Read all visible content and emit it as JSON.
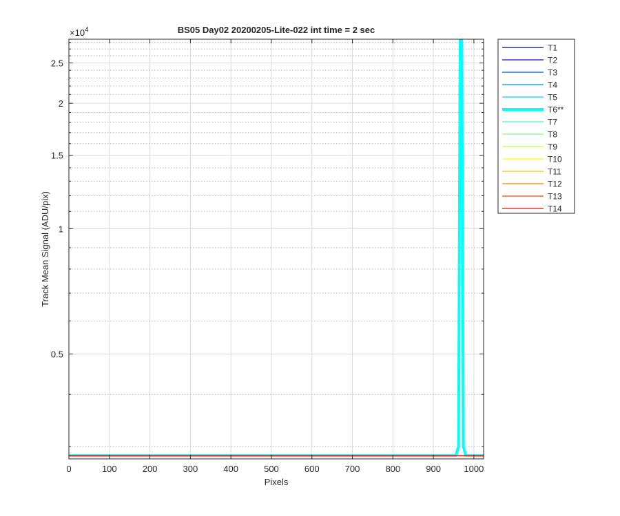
{
  "chart_data": {
    "type": "line",
    "title": "BS05 Day02 20200205-Lite-022 int time = 2 sec",
    "xlabel": "Pixels",
    "ylabel": "Track Mean Signal (ADU/pix)",
    "y_exponent_label": "×10",
    "y_exponent_power": "4",
    "y_scale": "log",
    "xlim": [
      0,
      1024
    ],
    "ylim": [
      2800,
      28500
    ],
    "grid": true,
    "legend_position": "outside-right",
    "x_ticks": [
      0,
      100,
      200,
      300,
      400,
      500,
      600,
      700,
      800,
      900,
      1000
    ],
    "x_tick_labels": [
      "0",
      "100",
      "200",
      "300",
      "400",
      "500",
      "600",
      "700",
      "800",
      "900",
      "1000"
    ],
    "y_ticks_major": [
      5000,
      10000,
      15000,
      20000,
      25000
    ],
    "y_tick_labels": [
      "0.5",
      "1",
      "1.5",
      "2",
      "2.5"
    ],
    "y_ticks_minor": [
      3000,
      4000,
      6000,
      7000,
      8000,
      9000,
      11000,
      12000,
      13000,
      14000,
      16000,
      17000,
      18000,
      19000,
      21000,
      22000,
      23000,
      24000,
      26000,
      27000,
      28000
    ],
    "baseline_value": 2850,
    "series": [
      {
        "name": "T1",
        "color": "#00008f",
        "width": 1.3,
        "values": []
      },
      {
        "name": "T2",
        "color": "#0010ff",
        "width": 1.3,
        "values": []
      },
      {
        "name": "T3",
        "color": "#0050ff",
        "width": 1.3,
        "values": []
      },
      {
        "name": "T4",
        "color": "#0090ff",
        "width": 1.3,
        "values": []
      },
      {
        "name": "T5",
        "color": "#00cfff",
        "width": 1.3,
        "values": []
      },
      {
        "name": "T6**",
        "color": "#00ffff",
        "width": 4,
        "values": [
          [
            0,
            2850
          ],
          [
            955,
            2850
          ],
          [
            962,
            3000
          ],
          [
            966,
            28500
          ],
          [
            970,
            28500
          ],
          [
            974,
            3000
          ],
          [
            980,
            2850
          ],
          [
            1024,
            2850
          ]
        ]
      },
      {
        "name": "T7",
        "color": "#40ffbf",
        "width": 1.3,
        "values": []
      },
      {
        "name": "T8",
        "color": "#80ff80",
        "width": 1.3,
        "values": []
      },
      {
        "name": "T9",
        "color": "#bfff40",
        "width": 1.3,
        "values": []
      },
      {
        "name": "T10",
        "color": "#ffff00",
        "width": 1.3,
        "values": []
      },
      {
        "name": "T11",
        "color": "#ffbf00",
        "width": 1.3,
        "values": []
      },
      {
        "name": "T12",
        "color": "#ff8000",
        "width": 1.3,
        "values": []
      },
      {
        "name": "T13",
        "color": "#ff4000",
        "width": 1.3,
        "values": []
      },
      {
        "name": "T14",
        "color": "#ff0000",
        "width": 1.3,
        "values": []
      }
    ]
  }
}
